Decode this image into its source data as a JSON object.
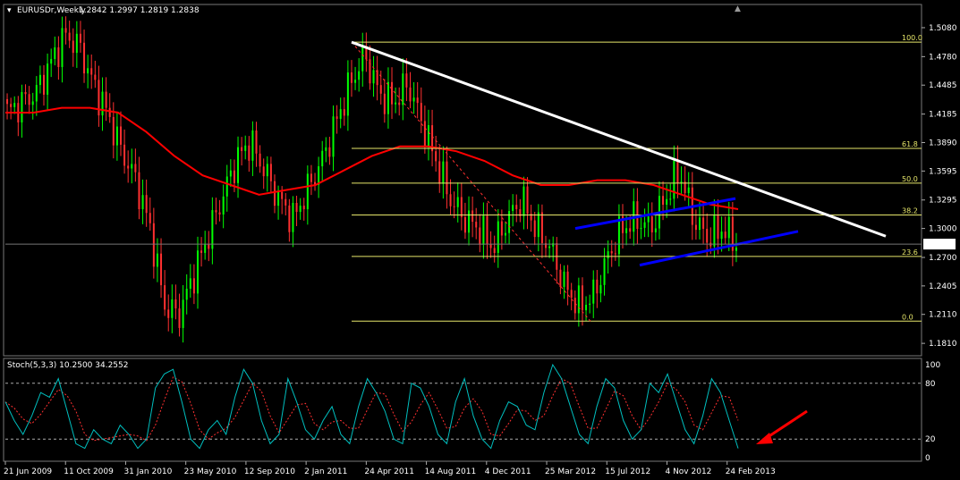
{
  "chart_data": [
    {
      "type": "candlestick",
      "symbol_header": "EURUSDr,Weekly",
      "ohlc": "1.2842 1.2997 1.2819 1.2838",
      "price_labels": [
        "1.5080",
        "1.4780",
        "1.4485",
        "1.4185",
        "1.3890",
        "1.3595",
        "1.3295",
        "1.3000",
        "1.2700",
        "1.2405",
        "1.2110",
        "1.1810"
      ],
      "ylim": [
        1.17,
        1.52
      ],
      "current_price": "1.2838",
      "date_labels": [
        "21 Jun 2009",
        "11 Oct 2009",
        "31 Jan 2010",
        "23 May 2010",
        "12 Sep 2010",
        "2 Jan 2011",
        "24 Apr 2011",
        "14 Aug 2011",
        "4 Dec 2011",
        "25 Mar 2012",
        "15 Jul 2012",
        "4 Nov 2012",
        "24 Feb 2013"
      ],
      "close_series": [
        1.42,
        1.43,
        1.44,
        1.47,
        1.5,
        1.49,
        1.45,
        1.42,
        1.38,
        1.35,
        1.3,
        1.22,
        1.21,
        1.25,
        1.29,
        1.33,
        1.37,
        1.39,
        1.36,
        1.33,
        1.31,
        1.34,
        1.37,
        1.41,
        1.45,
        1.48,
        1.44,
        1.43,
        1.45,
        1.41,
        1.37,
        1.33,
        1.31,
        1.3,
        1.28,
        1.31,
        1.33,
        1.3,
        1.28,
        1.24,
        1.22,
        1.23,
        1.27,
        1.3,
        1.31,
        1.3,
        1.33,
        1.36,
        1.31,
        1.29,
        1.3,
        1.285
      ],
      "moving_average": [
        1.42,
        1.42,
        1.425,
        1.425,
        1.42,
        1.4,
        1.375,
        1.355,
        1.345,
        1.335,
        1.34,
        1.345,
        1.36,
        1.375,
        1.385,
        1.385,
        1.38,
        1.37,
        1.355,
        1.345,
        1.345,
        1.35,
        1.35,
        1.345,
        1.335,
        1.325,
        1.32
      ],
      "fibonacci_levels": [
        {
          "label": "100.0",
          "price": 1.493
        },
        {
          "label": "61.8",
          "price": 1.383
        },
        {
          "label": "50.0",
          "price": 1.347
        },
        {
          "label": "38.2",
          "price": 1.314
        },
        {
          "label": "23.6",
          "price": 1.271
        },
        {
          "label": "0.0",
          "price": 1.204
        }
      ],
      "colors": {
        "bull": "#00ff00",
        "bear": "#ff3030",
        "ma": "#ff0000",
        "fib": "#e6e66a",
        "trendline": "#ffffff",
        "channel": "#0000ff",
        "grid": "#777777"
      }
    },
    {
      "type": "line",
      "header": "Stoch(5,3,3) 10.2500 34.2552",
      "axis_labels": [
        "100",
        "80",
        "20",
        "0"
      ],
      "ylim": [
        0,
        100
      ],
      "levels": [
        80,
        20
      ],
      "main": [
        60,
        40,
        25,
        45,
        70,
        65,
        85,
        50,
        15,
        10,
        30,
        20,
        15,
        35,
        25,
        10,
        20,
        75,
        90,
        95,
        60,
        20,
        10,
        30,
        40,
        25,
        65,
        95,
        80,
        40,
        15,
        25,
        85,
        60,
        30,
        20,
        40,
        55,
        25,
        15,
        55,
        85,
        70,
        50,
        20,
        15,
        80,
        75,
        55,
        25,
        15,
        60,
        85,
        45,
        20,
        10,
        40,
        60,
        55,
        35,
        30,
        70,
        100,
        85,
        55,
        25,
        15,
        55,
        85,
        75,
        40,
        20,
        30,
        80,
        70,
        90,
        60,
        30,
        15,
        45,
        85,
        70,
        40,
        10
      ],
      "signal_colors": {
        "main": "#00bfbf",
        "signal": "#ff3030"
      },
      "annotation_color": "#ff0000"
    }
  ]
}
